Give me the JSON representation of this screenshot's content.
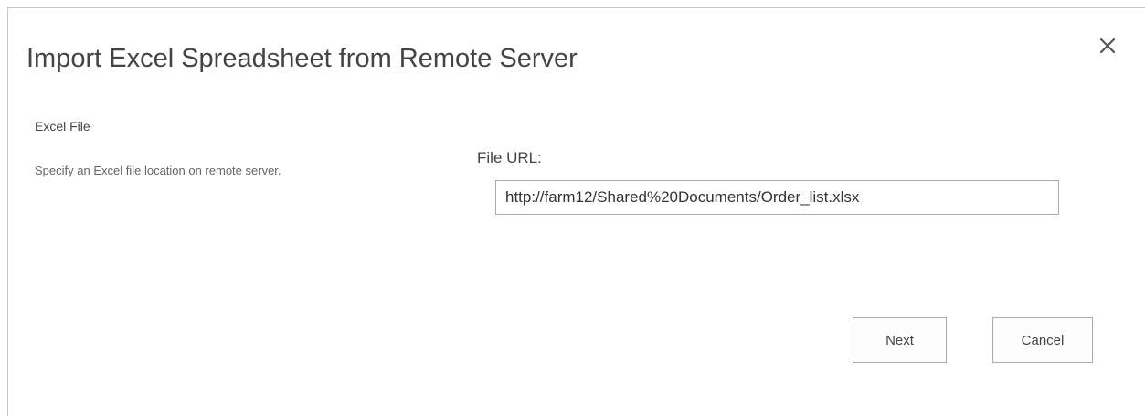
{
  "dialog": {
    "title": "Import Excel Spreadsheet from Remote Server",
    "close_icon": "close-icon"
  },
  "section": {
    "title": "Excel File",
    "description": "Specify an Excel file location on remote server."
  },
  "file_url": {
    "label": "File URL:",
    "value": "http://farm12/Shared%20Documents/Order_list.xlsx"
  },
  "buttons": {
    "next_label": "Next",
    "cancel_label": "Cancel"
  }
}
